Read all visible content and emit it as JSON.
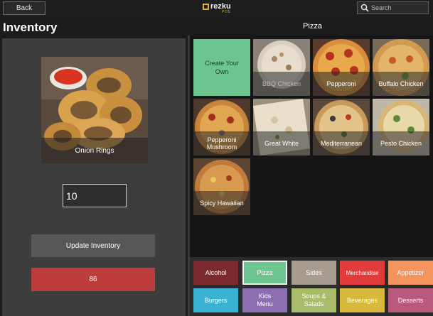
{
  "header": {
    "back_label": "Back",
    "logo_text": "rezku",
    "logo_subtext": "POS",
    "search_placeholder": "Search"
  },
  "page_title": "Inventory",
  "category_title": "Pizza",
  "selected_item": {
    "name": "Onion Rings",
    "quantity": "10",
    "update_label": "Update Inventory",
    "eighty_six_label": "86"
  },
  "menu_tiles": [
    {
      "label": "Create Your Own",
      "kind": "create",
      "color": "#6cc58f"
    },
    {
      "label": "BBQ Chicken",
      "kind": "photo",
      "dim": true
    },
    {
      "label": "Pepperoni",
      "kind": "photo"
    },
    {
      "label": "Buffalo Chicken",
      "kind": "photo"
    },
    {
      "label": "Pepperoni Mushroom",
      "kind": "photo"
    },
    {
      "label": "Great White",
      "kind": "photo"
    },
    {
      "label": "Mediterranean",
      "kind": "photo"
    },
    {
      "label": "Pesto Chicken",
      "kind": "photo"
    },
    {
      "label": "Spicy Hawaiian",
      "kind": "photo"
    }
  ],
  "categories": [
    {
      "label": "Alcohol",
      "color": "#7b2a2e",
      "selected": false
    },
    {
      "label": "Pizza",
      "color": "#6cc58f",
      "selected": true
    },
    {
      "label": "Sides",
      "color": "#a69c90",
      "selected": false
    },
    {
      "label": "Merchandise",
      "color": "#e23b3b",
      "selected": false
    },
    {
      "label": "Appetizer",
      "color": "#f2945b",
      "selected": false
    },
    {
      "label": "Burgers",
      "color": "#3ab2d4",
      "selected": false
    },
    {
      "label": "Kids Menu",
      "color": "#8c6fb3",
      "selected": false
    },
    {
      "label": "Soups & Salads",
      "color": "#a8bb6a",
      "selected": false
    },
    {
      "label": "Beverages",
      "color": "#d7ba3c",
      "selected": false
    },
    {
      "label": "Desserts",
      "color": "#b9597e",
      "selected": false
    }
  ]
}
